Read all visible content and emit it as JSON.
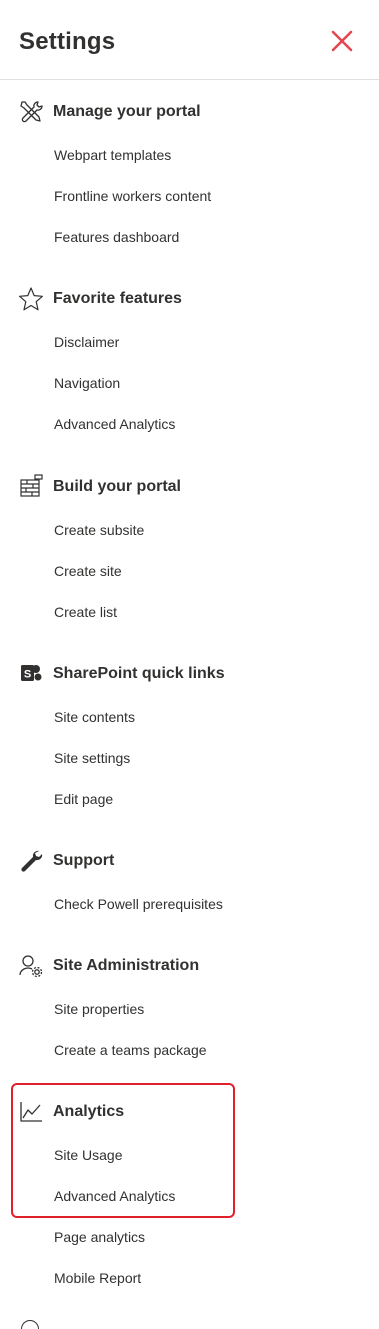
{
  "panel": {
    "title": "Settings",
    "close_icon": "close-icon",
    "accent_color": "#e3474f"
  },
  "sections": [
    {
      "key": "manage",
      "title": "Manage your portal",
      "icon": "tools-icon",
      "items": [
        "Webpart templates",
        "Frontline workers content",
        "Features dashboard"
      ]
    },
    {
      "key": "favorite",
      "title": "Favorite features",
      "icon": "star-icon",
      "items": [
        "Disclaimer",
        "Navigation",
        "Advanced Analytics"
      ]
    },
    {
      "key": "build",
      "title": "Build your portal",
      "icon": "build-icon",
      "items": [
        "Create subsite",
        "Create site",
        "Create list"
      ]
    },
    {
      "key": "sharepoint",
      "title": "SharePoint quick links",
      "icon": "sharepoint-icon",
      "items": [
        "Site contents",
        "Site settings",
        "Edit page"
      ]
    },
    {
      "key": "support",
      "title": "Support",
      "icon": "wrench-icon",
      "items": [
        "Check Powell prerequisites"
      ]
    },
    {
      "key": "siteadmin",
      "title": "Site Administration",
      "icon": "user-settings-icon",
      "items": [
        "Site properties",
        "Create a teams package"
      ]
    },
    {
      "key": "analytics",
      "title": "Analytics",
      "icon": "line-chart-icon",
      "items": [
        "Site Usage",
        "Advanced Analytics",
        "Page analytics",
        "Mobile Report"
      ]
    }
  ],
  "highlight_color": "#e0202a"
}
